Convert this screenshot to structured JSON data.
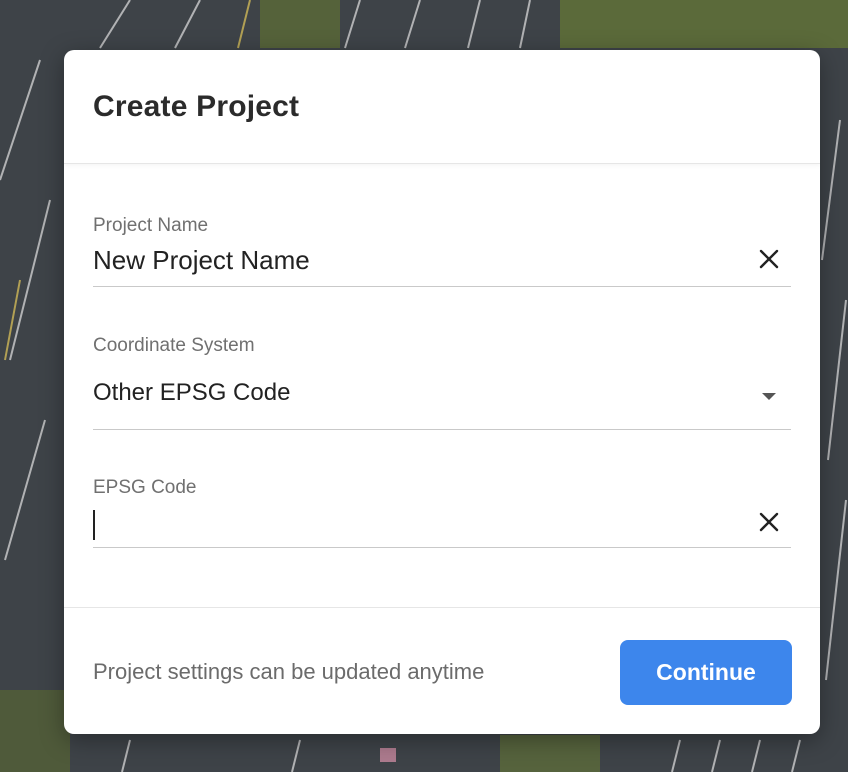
{
  "dialog": {
    "title": "Create Project",
    "fields": {
      "project_name": {
        "label": "Project Name",
        "value": "New Project Name",
        "clear_icon": "close-icon"
      },
      "coordinate_system": {
        "label": "Coordinate System",
        "value": "Other EPSG Code",
        "dropdown_icon": "caret-down-icon"
      },
      "epsg_code": {
        "label": "EPSG Code",
        "value": "",
        "clear_icon": "close-icon"
      }
    },
    "footer": {
      "note": "Project settings can be updated anytime",
      "continue_label": "Continue"
    }
  },
  "colors": {
    "primary_button": "#3d86ec",
    "title_text": "#2b2b2b",
    "label_text": "#707070",
    "divider": "#c9c9c9"
  }
}
